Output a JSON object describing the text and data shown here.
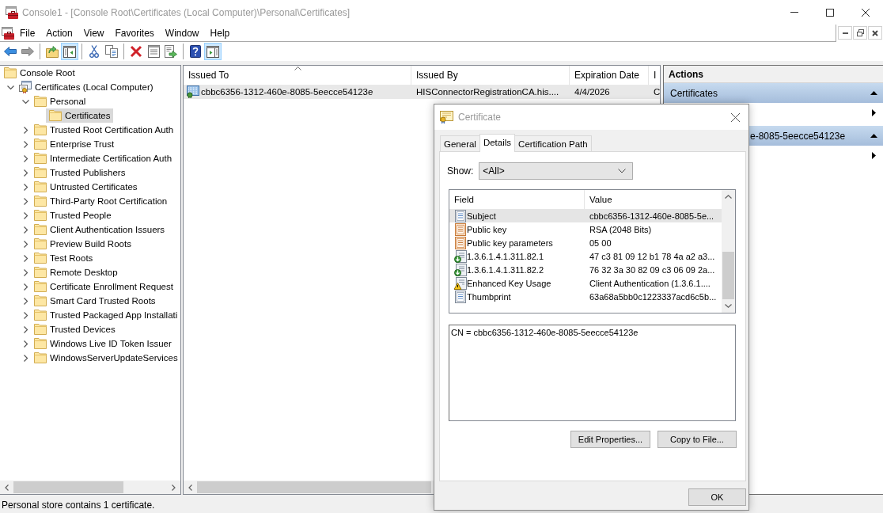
{
  "window": {
    "title": "Console1 - [Console Root\\Certificates (Local Computer)\\Personal\\Certificates]"
  },
  "menu": [
    "File",
    "Action",
    "View",
    "Favorites",
    "Window",
    "Help"
  ],
  "toolbar": [
    [
      {
        "kind": "back",
        "pressed": false,
        "disabled": false
      },
      {
        "kind": "forward",
        "pressed": false,
        "disabled": true
      }
    ],
    [
      {
        "kind": "up",
        "pressed": false,
        "disabled": false
      },
      {
        "kind": "tree",
        "pressed": true,
        "disabled": false
      }
    ],
    [
      {
        "kind": "cut",
        "pressed": false,
        "disabled": false
      },
      {
        "kind": "copy",
        "pressed": false,
        "disabled": false
      }
    ],
    [
      {
        "kind": "delete",
        "pressed": false,
        "disabled": false
      },
      {
        "kind": "properties",
        "pressed": false,
        "disabled": false
      },
      {
        "kind": "export",
        "pressed": false,
        "disabled": false
      }
    ],
    [
      {
        "kind": "help",
        "pressed": false,
        "disabled": false
      },
      {
        "kind": "actions",
        "pressed": true,
        "disabled": false
      }
    ]
  ],
  "tree": [
    {
      "label": "Console Root",
      "kind": "folder",
      "selected": false,
      "children": [
        {
          "label": "Certificates (Local Computer)",
          "kind": "snapin",
          "selected": false,
          "expanded": true,
          "children": [
            {
              "label": "Personal",
              "kind": "folder",
              "selected": false,
              "expanded": true,
              "children": [
                {
                  "label": "Certificates",
                  "kind": "folder",
                  "selected": true
                }
              ]
            },
            {
              "label": "Trusted Root Certification Auth",
              "kind": "folder",
              "selected": false,
              "expanded": false
            },
            {
              "label": "Enterprise Trust",
              "kind": "folder",
              "selected": false,
              "expanded": false
            },
            {
              "label": "Intermediate Certification Auth",
              "kind": "folder",
              "selected": false,
              "expanded": false
            },
            {
              "label": "Trusted Publishers",
              "kind": "folder",
              "selected": false,
              "expanded": false
            },
            {
              "label": "Untrusted Certificates",
              "kind": "folder",
              "selected": false,
              "expanded": false
            },
            {
              "label": "Third-Party Root Certification",
              "kind": "folder",
              "selected": false,
              "expanded": false
            },
            {
              "label": "Trusted People",
              "kind": "folder",
              "selected": false,
              "expanded": false
            },
            {
              "label": "Client Authentication Issuers",
              "kind": "folder",
              "selected": false,
              "expanded": false
            },
            {
              "label": "Preview Build Roots",
              "kind": "folder",
              "selected": false,
              "expanded": false
            },
            {
              "label": "Test Roots",
              "kind": "folder",
              "selected": false,
              "expanded": false
            },
            {
              "label": "Remote Desktop",
              "kind": "folder",
              "selected": false,
              "expanded": false
            },
            {
              "label": "Certificate Enrollment Request",
              "kind": "folder",
              "selected": false,
              "expanded": false
            },
            {
              "label": "Smart Card Trusted Roots",
              "kind": "folder",
              "selected": false,
              "expanded": false
            },
            {
              "label": "Trusted Packaged App Installati",
              "kind": "folder",
              "selected": false,
              "expanded": false
            },
            {
              "label": "Trusted Devices",
              "kind": "folder",
              "selected": false,
              "expanded": false
            },
            {
              "label": "Windows Live ID Token Issuer",
              "kind": "folder",
              "selected": false,
              "expanded": false
            },
            {
              "label": "WindowsServerUpdateServices",
              "kind": "folder",
              "selected": false,
              "expanded": false
            }
          ]
        }
      ]
    }
  ],
  "list": {
    "columns": [
      {
        "label": "Issued To",
        "sorted": true
      },
      {
        "label": "Issued By",
        "sorted": false
      },
      {
        "label": "Expiration Date",
        "sorted": false
      },
      {
        "label": "I",
        "sorted": false
      }
    ],
    "rows": [
      {
        "cells": [
          "cbbc6356-1312-460e-8085-5eecce54123e",
          "HISConnectorRegistrationCA.his....",
          "4/4/2026",
          "C"
        ],
        "selected": true
      }
    ]
  },
  "actions": {
    "title": "Actions",
    "groups": [
      {
        "title": "Certificates",
        "expanded": true,
        "rows": [
          {
            "submenu": true
          }
        ]
      },
      {
        "title": "e-8085-5eecce54123e",
        "expanded": true,
        "rows": [
          {
            "submenu": true
          }
        ]
      }
    ]
  },
  "status_bar": {
    "text": "Personal store contains 1 certificate."
  },
  "dialog": {
    "title": "Certificate",
    "tabs": [
      {
        "label": "General",
        "selected": false
      },
      {
        "label": "Details",
        "selected": true
      },
      {
        "label": "Certification Path",
        "selected": false
      }
    ],
    "show": {
      "label": "Show:",
      "value": "<All>"
    },
    "fields": {
      "columns": [
        "Field",
        "Value"
      ],
      "rows": [
        {
          "field": "Subject",
          "value": "cbbc6356-1312-460e-8085-5e...",
          "kind": "property",
          "selected": true
        },
        {
          "field": "Public key",
          "value": "RSA (2048 Bits)",
          "kind": "key",
          "selected": false
        },
        {
          "field": "Public key parameters",
          "value": "05 00",
          "kind": "key",
          "selected": false
        },
        {
          "field": "1.3.6.1.4.1.311.82.1",
          "value": "47 c3 81 09 12 b1 78 4a a2 a3...",
          "kind": "extension",
          "selected": false
        },
        {
          "field": "1.3.6.1.4.1.311.82.2",
          "value": "76 32 3a 30 82 09 c3 06 09 2a...",
          "kind": "extension",
          "selected": false
        },
        {
          "field": "Enhanced Key Usage",
          "value": "Client Authentication (1.3.6.1....",
          "kind": "warning",
          "selected": false
        },
        {
          "field": "Thumbprint",
          "value": "63a68a5bb0c1223337acd6c5b...",
          "kind": "property",
          "selected": false
        }
      ]
    },
    "detail": "CN = cbbc6356-1312-460e-8085-5eecce54123e",
    "buttons": [
      "Edit Properties...",
      "Copy to File..."
    ],
    "ok": "OK"
  }
}
